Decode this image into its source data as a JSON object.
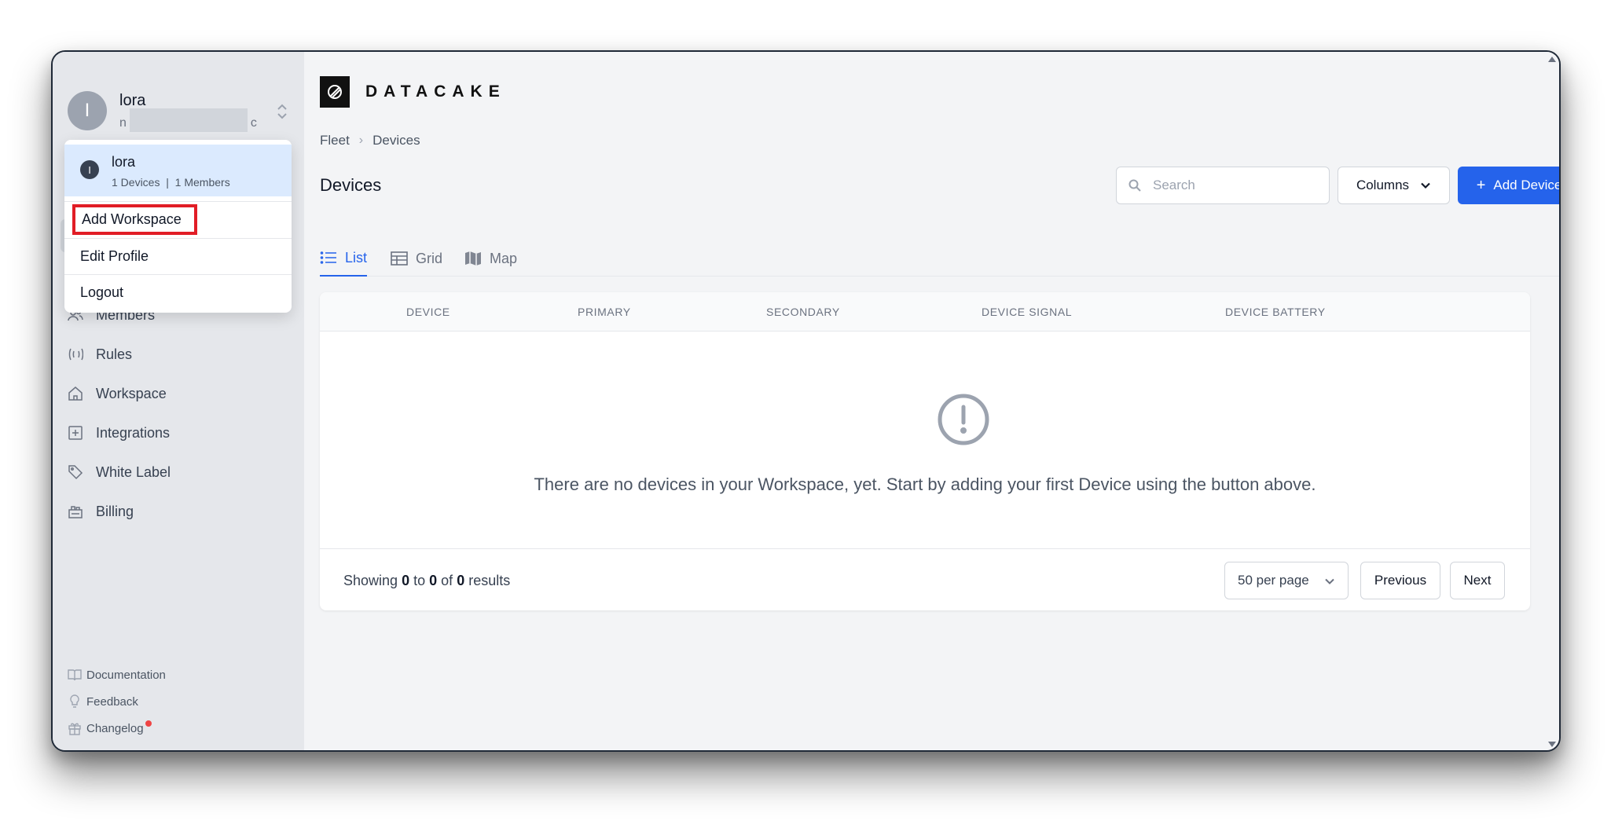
{
  "user": {
    "initial": "I",
    "name": "lora",
    "sub_prefix": "n",
    "sub_suffix": "c"
  },
  "workspace_menu": {
    "workspace": {
      "initial": "I",
      "name": "lora",
      "devices": "1 Devices",
      "separator": "|",
      "members": "1 Members"
    },
    "add_workspace": "Add Workspace",
    "edit_profile": "Edit Profile",
    "logout": "Logout"
  },
  "sidebar": {
    "items": [
      {
        "label": "Members",
        "icon": "users-icon"
      },
      {
        "label": "Rules",
        "icon": "rules-icon"
      },
      {
        "label": "Workspace",
        "icon": "home-icon"
      },
      {
        "label": "Integrations",
        "icon": "plus-square-icon"
      },
      {
        "label": "White Label",
        "icon": "tag-icon"
      },
      {
        "label": "Billing",
        "icon": "billing-icon"
      }
    ],
    "footer": {
      "documentation": "Documentation",
      "feedback": "Feedback",
      "changelog": "Changelog"
    }
  },
  "brand": {
    "name": "DATACAKE"
  },
  "breadcrumb": {
    "first": "Fleet",
    "second": "Devices"
  },
  "page": {
    "title": "Devices"
  },
  "toolbar": {
    "search_placeholder": "Search",
    "columns_label": "Columns",
    "add_label": "Add Device"
  },
  "tabs": [
    {
      "label": "List",
      "icon": "list-icon",
      "active": true
    },
    {
      "label": "Grid",
      "icon": "table-icon",
      "active": false
    },
    {
      "label": "Map",
      "icon": "map-icon",
      "active": false
    }
  ],
  "table": {
    "headers": [
      "DEVICE",
      "PRIMARY",
      "SECONDARY",
      "DEVICE SIGNAL",
      "DEVICE BATTERY"
    ],
    "empty_message": "There are no devices in your Workspace, yet. Start by adding your first Device using the button above."
  },
  "pagination": {
    "showing_prefix": "Showing",
    "from": "0",
    "to_word": "to",
    "to": "0",
    "of_word": "of",
    "total": "0",
    "results_word": "results",
    "per_page": "50 per page",
    "previous": "Previous",
    "next": "Next"
  },
  "colors": {
    "accent": "#2563eb",
    "highlight": "#e11d26",
    "changelog_dot": "#ef4444"
  }
}
